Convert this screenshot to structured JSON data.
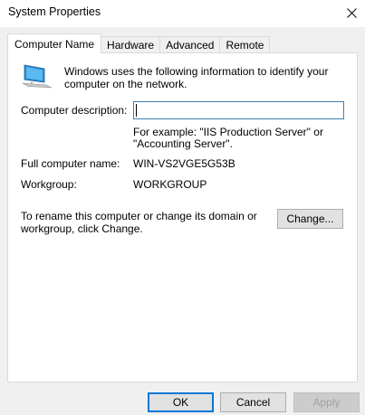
{
  "window": {
    "title": "System Properties"
  },
  "tabs": [
    {
      "label": "Computer Name",
      "active": true
    },
    {
      "label": "Hardware",
      "active": false
    },
    {
      "label": "Advanced",
      "active": false
    },
    {
      "label": "Remote",
      "active": false
    }
  ],
  "panel": {
    "intro": "Windows uses the following information to identify your computer on the network.",
    "description_label": "Computer description:",
    "description_value": "",
    "example_text": "For example: \"IIS Production Server\" or \"Accounting Server\".",
    "full_name_label": "Full computer name:",
    "full_name_value": "WIN-VS2VGE5G53B",
    "workgroup_label": "Workgroup:",
    "workgroup_value": "WORKGROUP",
    "rename_text": "To rename this computer or change its domain or workgroup, click Change.",
    "change_label": "Change..."
  },
  "footer": {
    "ok_label": "OK",
    "cancel_label": "Cancel",
    "apply_label": "Apply"
  },
  "icons": {
    "close": "close-icon",
    "computer": "computer-icon"
  },
  "colors": {
    "focus_border": "#3c7fb1",
    "default_button_border": "#0078d7",
    "panel_background": "#ffffff",
    "dialog_background": "#f0f0f0"
  }
}
